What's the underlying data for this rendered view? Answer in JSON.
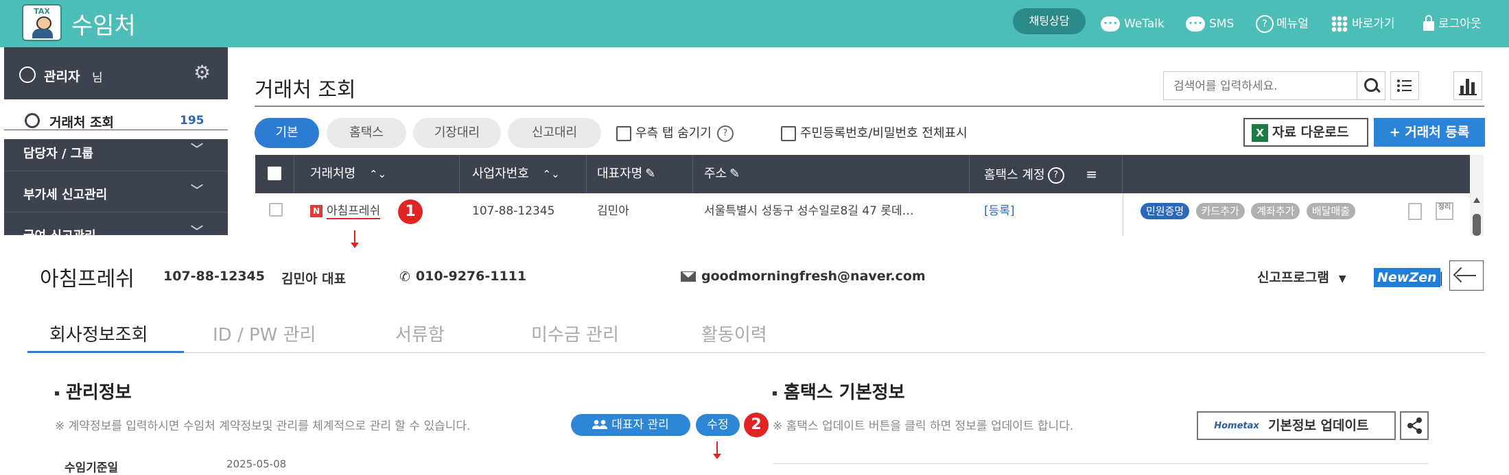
{
  "topbar": {
    "logo_text": "TAX",
    "app_title": "수임처",
    "chat_button": "채팅상담",
    "wetalk": "WeTalk",
    "sms": "SMS",
    "manual": "메뉴얼",
    "shortcuts": "바로가기",
    "logout": "로그아웃",
    "bg_color": "#4dbdb7"
  },
  "sidebar": {
    "admin_name": "관리자",
    "admin_suffix": "님",
    "current_item": "거래처 조회",
    "current_count": "195",
    "menus": [
      {
        "label": "담당자 / 그룹"
      },
      {
        "label": "부가세 신고관리"
      },
      {
        "label": "급여 신고관리"
      }
    ]
  },
  "list": {
    "title": "거래처 조회",
    "search_placeholder": "검색어를 입력하세요.",
    "filter_tabs": [
      {
        "label": "기본",
        "active": true
      },
      {
        "label": "홈택스",
        "active": false
      },
      {
        "label": "기장대리",
        "active": false
      },
      {
        "label": "신고대리",
        "active": false
      }
    ],
    "hide_right_tab": "우측 탭 숨기기",
    "show_all_ids": "주민등록번호/비밀번호 전체표시",
    "download_button": "자료 다운로드",
    "register_button": "+ 거래처 등록",
    "columns": [
      "거래처명",
      "사업자번호",
      "대표자명",
      "주소",
      "홈택스 계정"
    ],
    "rows": [
      {
        "company_badge": "N",
        "company": "아침프레쉬",
        "biz_no": "107-88-12345",
        "ceo": "김민아",
        "address": "서울특별시 성동구 성수일로8길 47 롯데…",
        "hometax": "[등록]",
        "tags": [
          "민원증명",
          "카드추가",
          "계좌추가",
          "배달매출"
        ],
        "memo_icon_label": "정리"
      }
    ]
  },
  "steps": {
    "one": "1",
    "two": "2"
  },
  "detail": {
    "company": "아침프레쉬",
    "biz_no": "107-88-12345",
    "ceo": "김민아 대표",
    "phone": "010-9276-1111",
    "email": "goodmorningfresh@naver.com",
    "program_label": "신고프로그램",
    "program_badge": "NewZen",
    "separator": "|",
    "tabs": [
      {
        "label": "회사정보조회",
        "active": true
      },
      {
        "label": "ID / PW 관리",
        "active": false
      },
      {
        "label": "서류함",
        "active": false
      },
      {
        "label": "미수금 관리",
        "active": false
      },
      {
        "label": "활동이력",
        "active": false
      }
    ],
    "management": {
      "title": "관리정보",
      "note": "※ 계약정보를 입력하시면 수임처 계약정보및 관리를 체계적으로 관리 할 수 있습니다.",
      "rep_button": "대표자 관리",
      "edit_button": "수정",
      "row_label": "수임기준일",
      "row_value": "2025-05-08"
    },
    "hometax": {
      "title": "홈택스 기본정보",
      "note": "※ 홈택스 업데이트 버튼을 클릭 하면 정보를 업데이트 합니다.",
      "logo_text": "Hometax",
      "update_button": "기본정보 업데이트"
    }
  }
}
